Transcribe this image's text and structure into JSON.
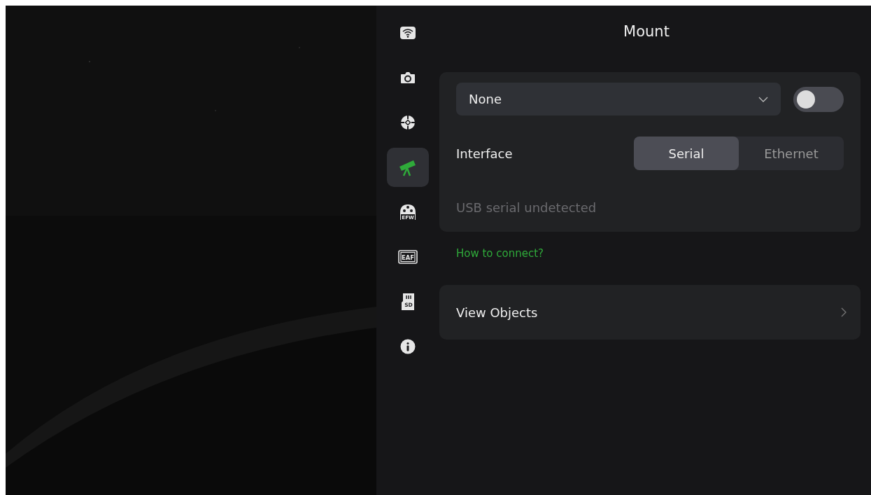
{
  "sidebar": {
    "items": [
      {
        "kind": "wifi",
        "selected": false
      },
      {
        "kind": "camera",
        "selected": false
      },
      {
        "kind": "crosshair",
        "selected": false
      },
      {
        "kind": "telescope",
        "selected": true
      },
      {
        "kind": "filter-wheel",
        "label": "EFW",
        "selected": false
      },
      {
        "kind": "focuser",
        "label": "EAF",
        "selected": false
      },
      {
        "kind": "sd-card",
        "label": "SD",
        "selected": false
      },
      {
        "kind": "info",
        "selected": false
      }
    ]
  },
  "title": "Mount",
  "mount": {
    "device": "None",
    "enabled": false,
    "interface_label": "Interface",
    "interfaces": [
      {
        "label": "Serial",
        "selected": true
      },
      {
        "label": "Ethernet",
        "selected": false
      }
    ],
    "status": "USB serial undetected"
  },
  "help_link": "How to connect?",
  "view_objects": "View Objects"
}
